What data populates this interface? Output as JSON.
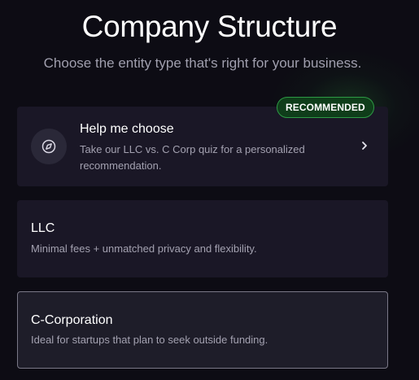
{
  "header": {
    "title": "Company Structure",
    "subtitle": "Choose the entity type that's right for your business."
  },
  "options": {
    "help": {
      "badge": "RECOMMENDED",
      "title": "Help me choose",
      "description": "Take our LLC vs. C Corp quiz for a personalized recommendation.",
      "icon": "compass-icon",
      "arrow_icon": "chevron-right-icon"
    },
    "llc": {
      "title": "LLC",
      "description": "Minimal fees + unmatched privacy and flexibility."
    },
    "ccorp": {
      "title": "C-Corporation",
      "description": "Ideal for startups that plan to seek outside funding."
    }
  },
  "colors": {
    "background": "#0d0c14",
    "card": "#1a1726",
    "badge_bg": "#0f3d1a",
    "badge_border": "#2e9a45",
    "selected_border": "#7a7887"
  }
}
